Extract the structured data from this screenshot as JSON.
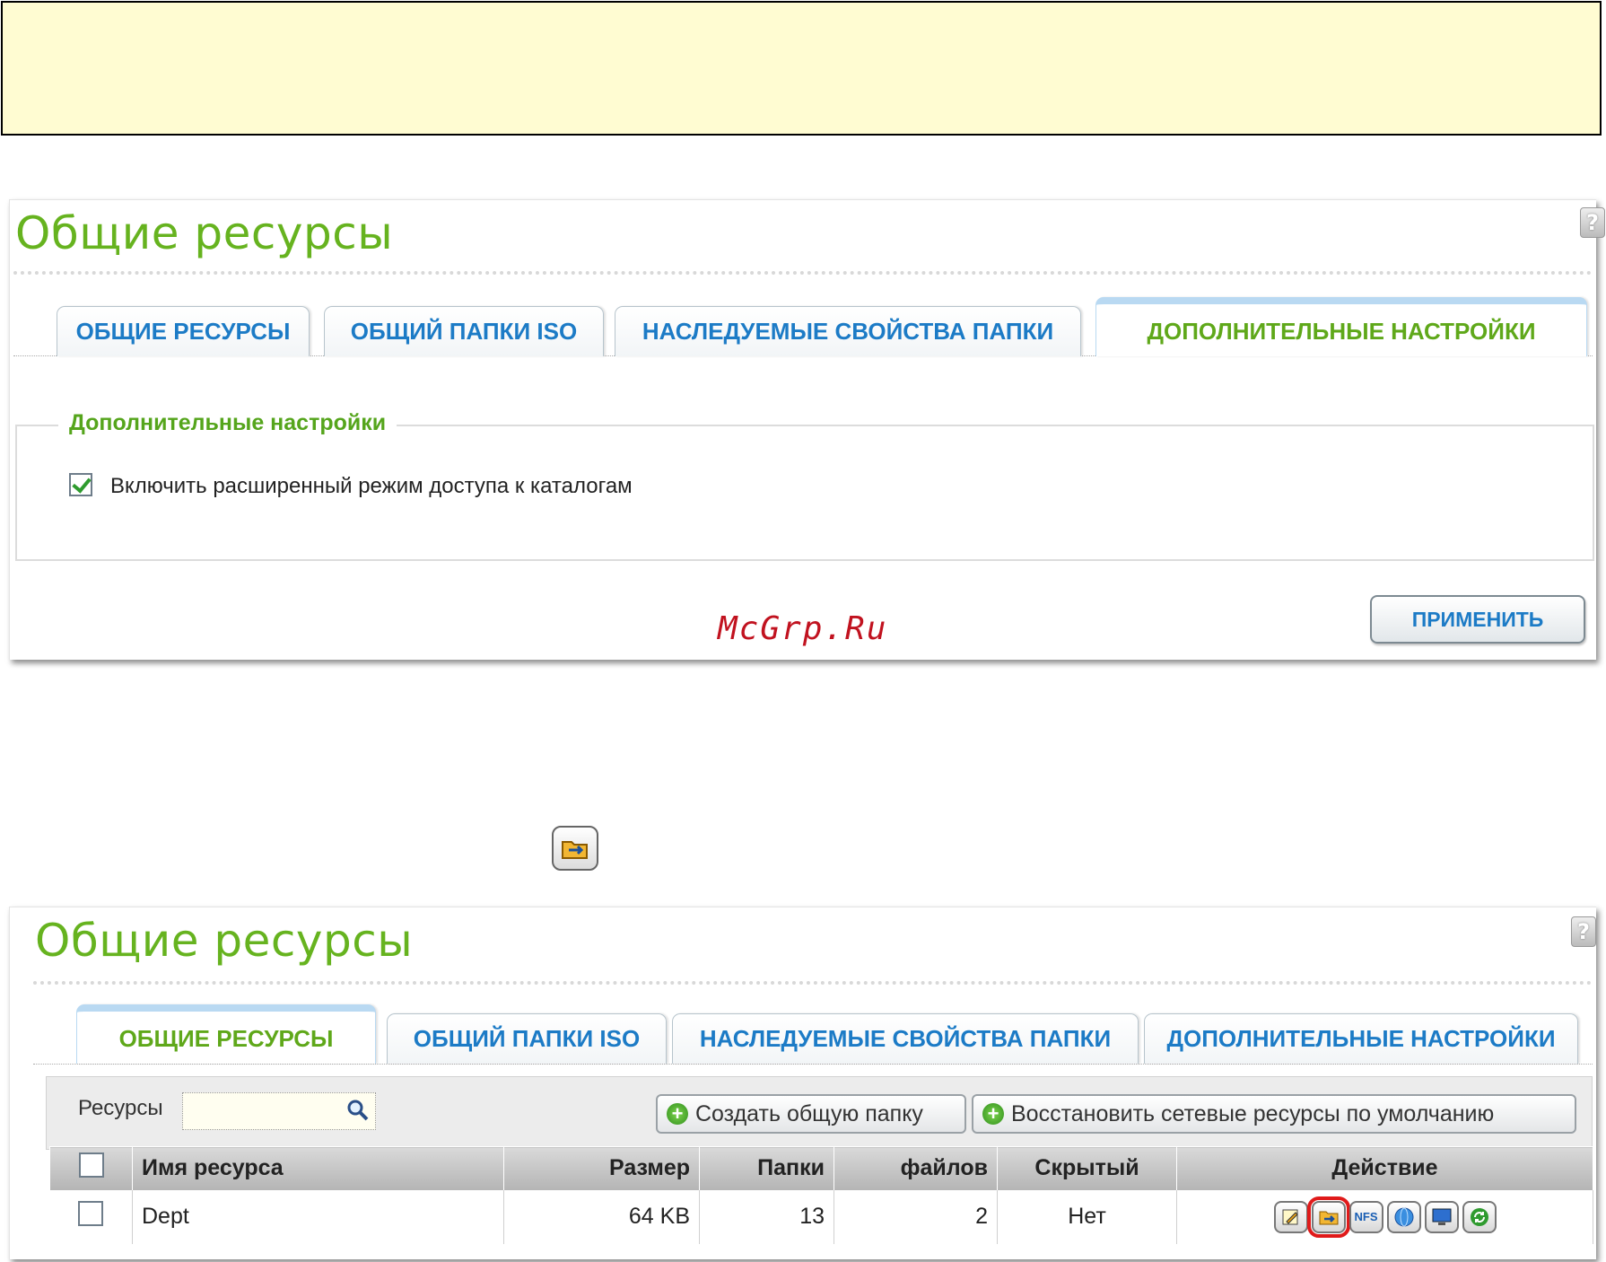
{
  "panel1": {
    "title": "Общие ресурсы",
    "tabs": [
      "ОБЩИЕ РЕСУРСЫ",
      "ОБЩИЙ ПАПКИ ISO",
      "НАСЛЕДУЕМЫЕ СВОЙСТВА ПАПКИ",
      "ДОПОЛНИТЕЛЬНЫЕ НАСТРОЙКИ"
    ],
    "active_tab": "ДОПОЛНИТЕЛЬНЫЕ НАСТРОЙКИ",
    "section_legend": "Дополнительные настройки",
    "checkbox_label": "Включить расширенный режим доступа к каталогам",
    "checkbox_checked": true,
    "apply_label": "ПРИМЕНИТЬ"
  },
  "watermark": "McGrp.Ru",
  "panel2": {
    "title": "Общие ресурсы",
    "tabs": [
      "ОБЩИЕ РЕСУРСЫ",
      "ОБЩИЙ ПАПКИ ISO",
      "НАСЛЕДУЕМЫЕ СВОЙСТВА ПАПКИ",
      "ДОПОЛНИТЕЛЬНЫЕ НАСТРОЙКИ"
    ],
    "active_tab": "ОБЩИЕ РЕСУРСЫ",
    "search_label": "Ресурсы",
    "create_button": "Создать общую папку",
    "restore_button": "Восстановить сетевые ресурсы по умолчанию",
    "table": {
      "headers": [
        "Имя ресурса",
        "Размер",
        "Папки",
        "файлов",
        "Скрытый",
        "Действие"
      ],
      "rows": [
        {
          "name": "Dept",
          "size": "64 KB",
          "folders": "13",
          "files": "2",
          "hidden": "Нет"
        }
      ]
    },
    "action_icons": [
      "edit-icon",
      "folder-permissions-icon",
      "nfs-icon",
      "network-access-icon",
      "computer-icon",
      "refresh-icon"
    ]
  },
  "colors": {
    "title_green": "#66b31f",
    "tab_blue": "#1c7bc6",
    "note_yellow": "#fffcd2",
    "highlight_red": "#e01a1a"
  }
}
